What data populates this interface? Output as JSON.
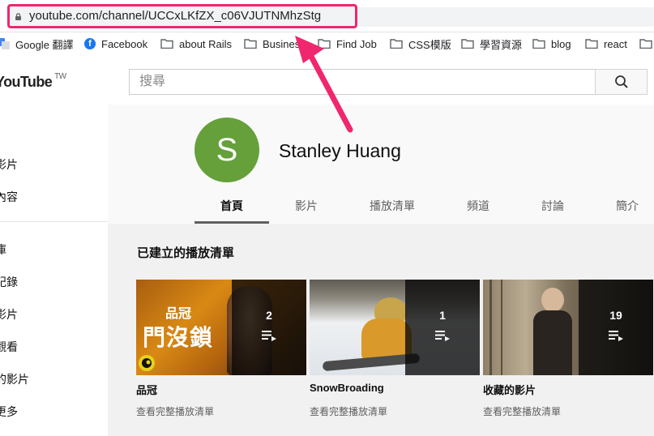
{
  "browser": {
    "url": "youtube.com/channel/UCCxLKfZX_c06VJUTNMhzStg",
    "highlight_color": "#f0266f"
  },
  "bookmarks": [
    {
      "label": "Google 翻譯",
      "icon": "google-translate-icon"
    },
    {
      "label": "Facebook",
      "icon": "facebook-icon"
    },
    {
      "label": "about Rails",
      "icon": "folder-icon"
    },
    {
      "label": "Business",
      "icon": "folder-icon"
    },
    {
      "label": "Find Job",
      "icon": "folder-icon"
    },
    {
      "label": "CSS模版",
      "icon": "folder-icon"
    },
    {
      "label": "學習資源",
      "icon": "folder-icon"
    },
    {
      "label": "blog",
      "icon": "folder-icon"
    },
    {
      "label": "react",
      "icon": "folder-icon"
    }
  ],
  "sidebar": {
    "logo": "YouTube",
    "logo_region": "TW",
    "items": [
      "影片",
      "內容",
      "庫",
      "記錄",
      "影片",
      "觀看",
      "的影片",
      "更多"
    ]
  },
  "search": {
    "placeholder": "搜尋",
    "button_icon": "search-icon"
  },
  "channel": {
    "avatar_letter": "S",
    "avatar_color": "#65a03a",
    "name": "Stanley Huang",
    "tabs": [
      "首頁",
      "影片",
      "播放清單",
      "頻道",
      "討論",
      "簡介"
    ],
    "active_tab": "首頁"
  },
  "playlists": {
    "section_title": "已建立的播放清單",
    "items": [
      {
        "title": "品冠",
        "count": "2",
        "link": "查看完整播放清單",
        "thumb_caption_small": "品冠",
        "thumb_caption_big": "門沒鎖"
      },
      {
        "title": "SnowBroading",
        "count": "1",
        "link": "查看完整播放清單"
      },
      {
        "title": "收藏的影片",
        "count": "19",
        "link": "查看完整播放清單"
      }
    ]
  }
}
